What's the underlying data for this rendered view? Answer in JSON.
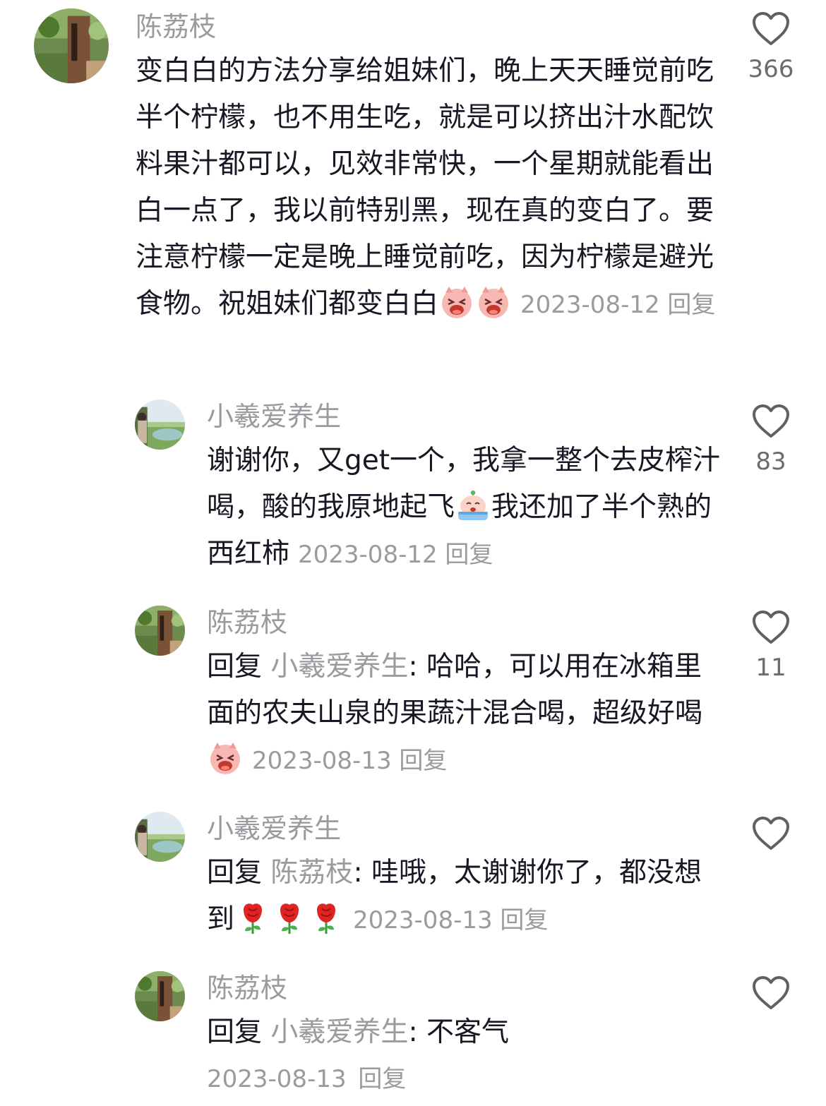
{
  "colors": {
    "text": "#161823",
    "muted": "#9a9a9f",
    "like_count": "#6b6b70",
    "heart_stroke": "#5f5f64"
  },
  "comments": [
    {
      "user": "陈荔枝",
      "text": "变白白的方法分享给姐妹们，晚上天天睡觉前吃半个柠檬，也不用生吃，就是可以挤出汁水配饮料果汁都可以，见效非常快，一个星期就能看出白一点了，我以前特别黑，现在真的变白了。要注意柠檬一定是晚上睡觉前吃，因为柠檬是避光食物。祝姐妹们都变白白",
      "emojis": [
        "laughing-pig-emoji",
        "laughing-pig-emoji"
      ],
      "date": "2023-08-12",
      "reply_label": "回复",
      "likes": "366"
    },
    {
      "user": "小羲爱养生",
      "text_a": "谢谢你，又get一个，我拿一整个去皮榨汁喝，酸的我原地起飞",
      "emoji": "crying-peach-emoji",
      "text_b": "我还加了半个熟的西红柿",
      "date": "2023-08-12",
      "reply_label": "回复",
      "likes": "83"
    },
    {
      "user": "陈荔枝",
      "prefix": "回复",
      "mention": "小羲爱养生",
      "text": ": 哈哈，可以用在冰箱里面的农夫山泉的果蔬汁混合喝，超级好喝",
      "emoji": "laughing-pig-emoji",
      "date": "2023-08-13",
      "reply_label": "回复",
      "likes": "11"
    },
    {
      "user": "小羲爱养生",
      "prefix": "回复",
      "mention": "陈荔枝",
      "text": ": 哇哦，太谢谢你了，都没想到",
      "emojis": [
        "rose-emoji",
        "rose-emoji",
        "rose-emoji"
      ],
      "date": "2023-08-13",
      "reply_label": "回复",
      "likes": ""
    },
    {
      "user": "陈荔枝",
      "prefix": "回复",
      "mention": "小羲爱养生",
      "text": ": 不客气",
      "date": "2023-08-13",
      "reply_label": "回复",
      "likes": ""
    }
  ]
}
